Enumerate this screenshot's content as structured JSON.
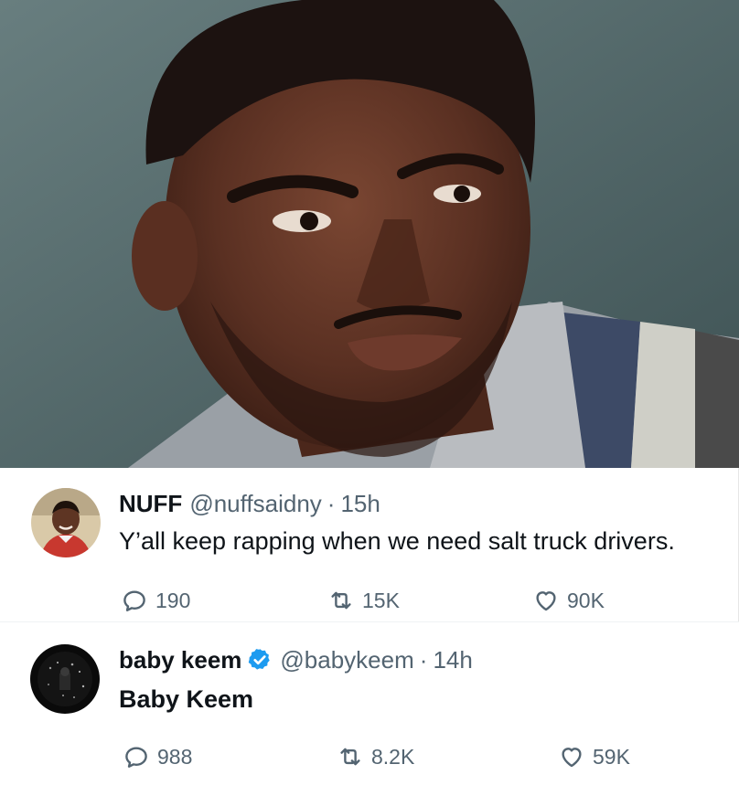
{
  "tweets": [
    {
      "display_name": "NUFF",
      "handle": "@nuffsaidny",
      "separator": "·",
      "time": "15h",
      "text": "Y’all keep rapping when we need salt truck drivers.",
      "verified": false,
      "replies": "190",
      "retweets": "15K",
      "likes": "90K"
    },
    {
      "display_name": "baby keem",
      "handle": "@babykeem",
      "separator": "·",
      "time": "14h",
      "text": "Baby Keem",
      "verified": true,
      "replies": "988",
      "retweets": "8.2K",
      "likes": "59K"
    }
  ],
  "colors": {
    "text_primary": "#0f1419",
    "text_secondary": "#536471",
    "verified_blue": "#1d9bf0"
  },
  "icons": [
    "reply-icon",
    "retweet-icon",
    "like-icon",
    "verified-badge-icon"
  ]
}
